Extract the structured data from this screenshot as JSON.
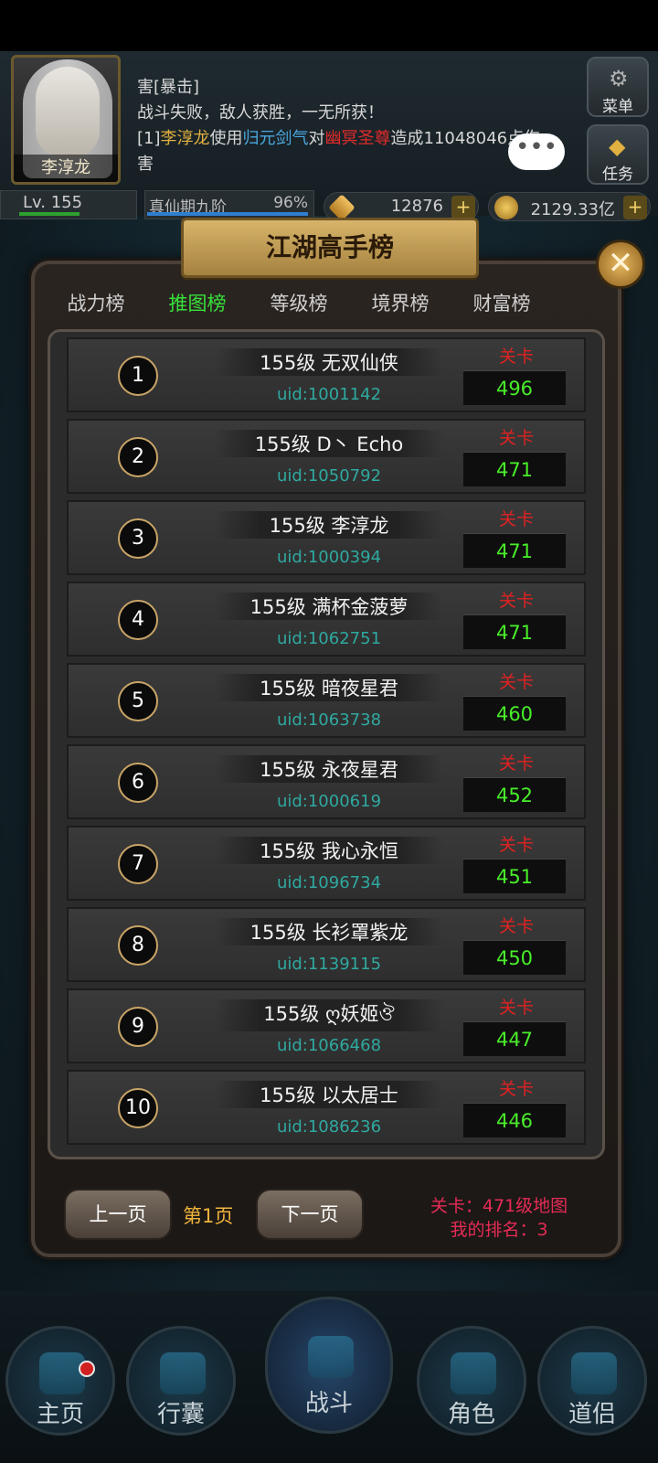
{
  "hud": {
    "player_name": "李淳龙",
    "log_lines": [
      {
        "parts": [
          {
            "t": "害[暴击]",
            "c": ""
          }
        ]
      },
      {
        "parts": [
          {
            "t": "战斗失败，敌人获胜，一无所获！",
            "c": ""
          }
        ]
      },
      {
        "parts": [
          {
            "t": "[1]",
            "c": ""
          },
          {
            "t": "李淳龙",
            "c": "gold"
          },
          {
            "t": "使用",
            "c": ""
          },
          {
            "t": "归元剑气",
            "c": "blue"
          },
          {
            "t": "对",
            "c": ""
          },
          {
            "t": "幽冥圣尊",
            "c": "red"
          },
          {
            "t": "造成11048046点伤",
            "c": ""
          }
        ]
      },
      {
        "parts": [
          {
            "t": "害",
            "c": ""
          }
        ]
      }
    ],
    "chat_bubble": "•••",
    "menu_label": "菜单",
    "task_label": "任务",
    "level_text": "Lv. 155",
    "realm_text": "真仙期九阶",
    "realm_progress": "96%",
    "gem_amount": "12876",
    "gold_amount": "2129.33亿",
    "plus": "+"
  },
  "panel": {
    "title": "江湖高手榜",
    "close": "✕",
    "tabs": [
      "战力榜",
      "推图榜",
      "等级榜",
      "境界榜",
      "财富榜"
    ],
    "active_tab": 1,
    "stage_label": "关卡",
    "rows": [
      {
        "rank": "1",
        "name": "155级 无双仙侠",
        "uid": "uid:1001142",
        "stage": "496"
      },
      {
        "rank": "2",
        "name": "155级 D丶 Echo",
        "uid": "uid:1050792",
        "stage": "471"
      },
      {
        "rank": "3",
        "name": "155级 李淳龙",
        "uid": "uid:1000394",
        "stage": "471"
      },
      {
        "rank": "4",
        "name": "155级 满杯金菠萝",
        "uid": "uid:1062751",
        "stage": "471"
      },
      {
        "rank": "5",
        "name": "155级 暗夜星君",
        "uid": "uid:1063738",
        "stage": "460"
      },
      {
        "rank": "6",
        "name": "155级 永夜星君",
        "uid": "uid:1000619",
        "stage": "452"
      },
      {
        "rank": "7",
        "name": "155级 我心永恒",
        "uid": "uid:1096734",
        "stage": "451"
      },
      {
        "rank": "8",
        "name": "155级 长衫罩紫龙",
        "uid": "uid:1139115",
        "stage": "450"
      },
      {
        "rank": "9",
        "name": "155级 ღ妖姬ঔ",
        "uid": "uid:1066468",
        "stage": "447"
      },
      {
        "rank": "10",
        "name": "155级 以太居士",
        "uid": "uid:1086236",
        "stage": "446"
      }
    ],
    "prev_page": "上一页",
    "page_no": "第1页",
    "next_page": "下一页",
    "my_stage": "关卡：471级地图",
    "my_rank": "我的排名：3"
  },
  "nav": {
    "home": "主页",
    "bag": "行囊",
    "battle": "战斗",
    "role": "角色",
    "partner": "道侣"
  },
  "colors": {
    "active_tab": "#37e03a",
    "stage_value": "#49ee2a",
    "stage_label": "#e02222",
    "uid": "#2fa9a0",
    "page_no": "#f0b43c",
    "my_info": "#e62b56"
  }
}
